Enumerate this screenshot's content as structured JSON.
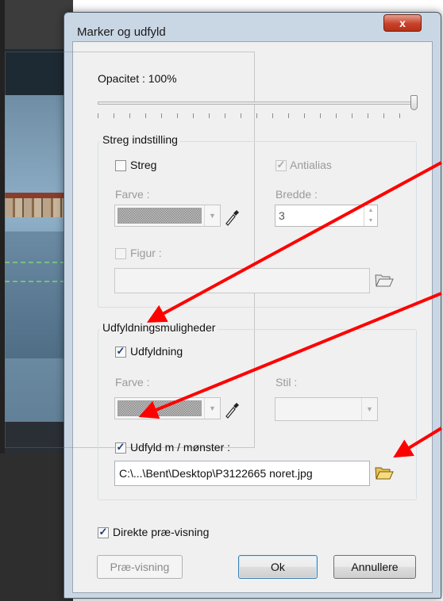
{
  "dialog": {
    "title": "Marker og udfyld",
    "close_symbol": "x"
  },
  "opacity": {
    "label": "Opacitet : 100%",
    "value_fraction": 1.0
  },
  "stroke_group": {
    "title": "Streg indstilling",
    "streg_label": "Streg",
    "streg_checked": false,
    "antialias_label": "Antialias",
    "antialias_checked": true,
    "color_label": "Farve :",
    "width_label": "Bredde :",
    "width_value": "3",
    "figure_label": "Figur :",
    "figure_checked": false,
    "figure_value": ""
  },
  "fill_group": {
    "title": "Udfyldningsmuligheder",
    "fill_label": "Udfyldning",
    "fill_checked": true,
    "color_label": "Farve :",
    "style_label": "Stil :",
    "style_value": "",
    "pattern_label": "Udfyld m / mønster :",
    "pattern_checked": true,
    "pattern_path": "C:\\...\\Bent\\Desktop\\P3122665 noret.jpg"
  },
  "preview": {
    "label": "Direkte præ-visning",
    "checked": true
  },
  "buttons": {
    "preview": "Præ-visning",
    "ok": "Ok",
    "cancel": "Annullere"
  },
  "colors": {
    "annotation_arrow": "#ff0000",
    "title_close": "#c8412a",
    "dialog_frame": "#c9d6e4"
  }
}
